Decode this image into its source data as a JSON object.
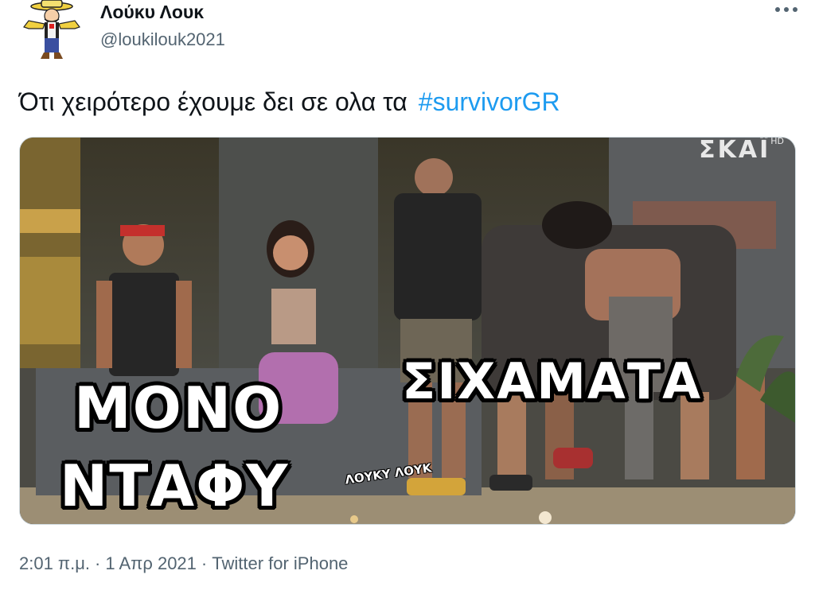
{
  "author": {
    "display_name": "Λούκυ Λουκ",
    "handle": "@loukilouk2021",
    "avatar_icon": "cowboy-avatar-icon"
  },
  "more_icon": "more-options-icon",
  "tweet": {
    "text": "Ότι χειρότερο έχουμε δει σε ολα τα",
    "hashtag": "#survivorGR"
  },
  "media": {
    "caption_left_line1": "ΜΟΝΟ",
    "caption_left_line2": "ΝΤΑΦΥ",
    "caption_right": "ΣΙΧΑΜΑΤΑ",
    "watermark": "ΛΟΥΚΥ ΛΟΥΚ",
    "channel_logo": "ΣΚΑΪ",
    "channel_logo_suffix": "HD"
  },
  "meta": {
    "time": "2:01 π.μ.",
    "date": "1 Απρ 2021",
    "source": "Twitter for iPhone",
    "separator": "·"
  },
  "colors": {
    "text": "#0f1419",
    "secondary": "#536471",
    "link": "#1d9bf0"
  }
}
